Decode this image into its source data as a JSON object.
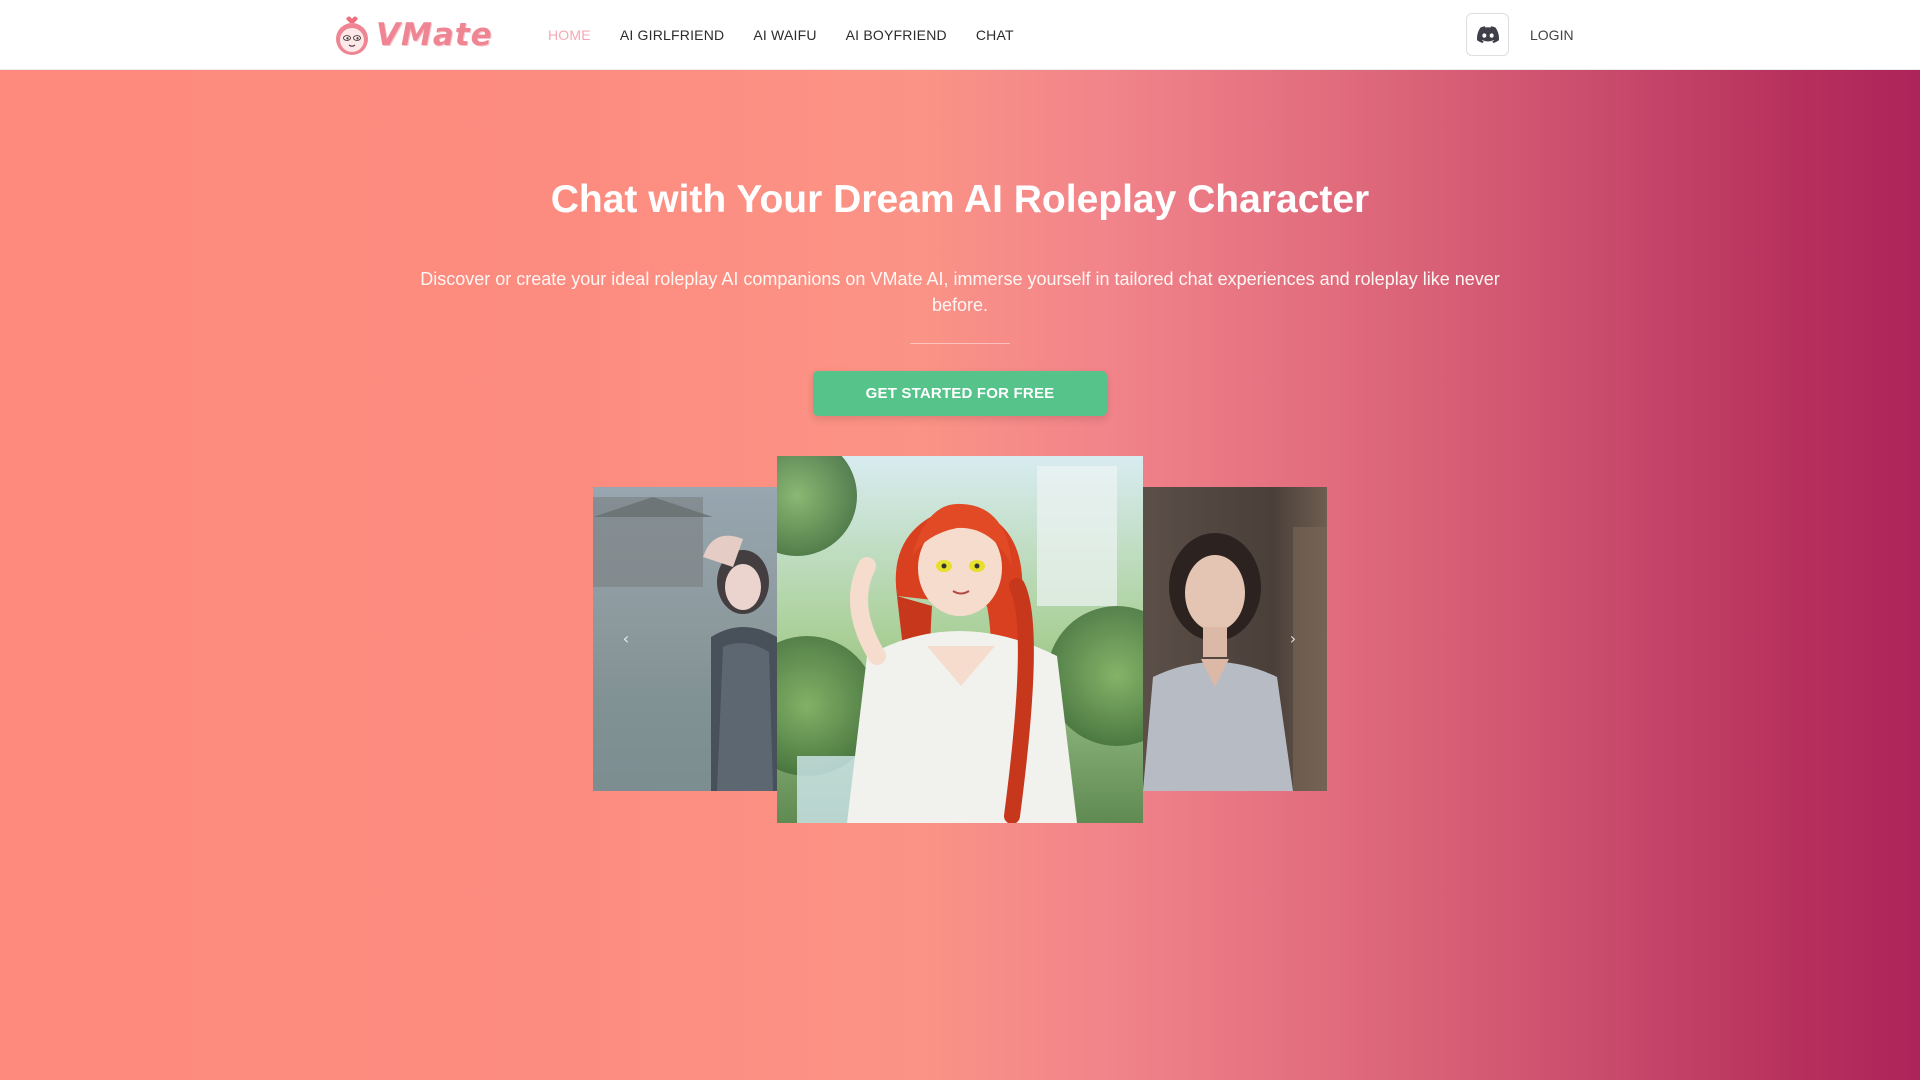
{
  "brand": {
    "name": "VMate",
    "accent_color": "#ef8592",
    "logo_icon": "strawberry-face-logo"
  },
  "nav": {
    "items": [
      {
        "label": "HOME",
        "active": true
      },
      {
        "label": "AI GIRLFRIEND",
        "active": false
      },
      {
        "label": "AI WAIFU",
        "active": false
      },
      {
        "label": "AI BOYFRIEND",
        "active": false
      },
      {
        "label": "CHAT",
        "active": false
      }
    ],
    "active_color": "#f6a9b3"
  },
  "header_actions": {
    "discord_icon": "discord-icon",
    "login_label": "LOGIN"
  },
  "hero": {
    "title": "Chat with Your Dream AI Roleplay Character",
    "subtitle": "Discover or create your ideal roleplay AI companions on VMate AI, immerse yourself in tailored chat experiences and roleplay like never before.",
    "cta_label": "GET STARTED FOR FREE",
    "cta_color": "#56c38a",
    "gradient_start": "#fd8a7c",
    "gradient_end": "#ad245a"
  },
  "carousel": {
    "prev_icon": "chevron-left-icon",
    "next_icon": "chevron-right-icon",
    "prev_glyph": "‹",
    "next_glyph": "›",
    "slides": [
      "dark-haired-woman-by-water",
      "red-haired-anime-girl",
      "woman-in-grey-tshirt"
    ]
  }
}
